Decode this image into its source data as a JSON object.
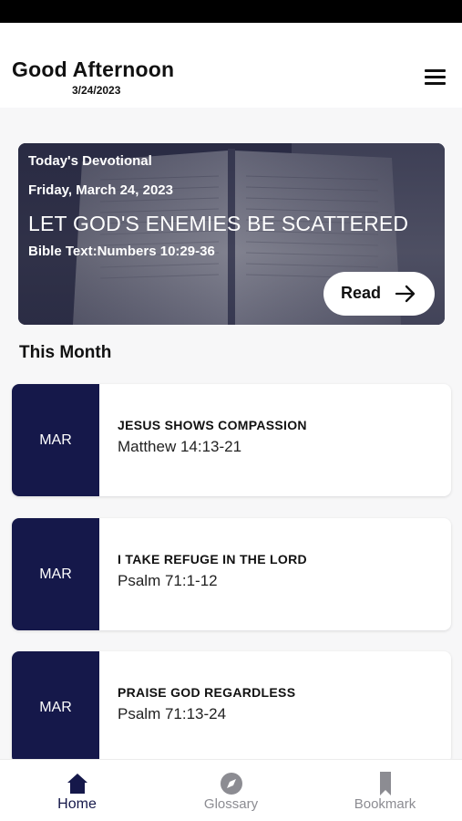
{
  "header": {
    "greeting": "Good Afternoon",
    "date": "3/24/2023",
    "menu_icon": "hamburger-menu-icon"
  },
  "hero": {
    "label": "Today's Devotional",
    "date": "Friday, March 24, 2023",
    "title": "LET GOD'S ENEMIES BE SCATTERED",
    "bible_text": "Bible Text:Numbers 10:29-36",
    "read_label": "Read",
    "read_icon": "arrow-right-icon"
  },
  "section": {
    "title": "This Month"
  },
  "devotionals": [
    {
      "month": "MAR",
      "title": "JESUS SHOWS COMPASSION",
      "reference": "Matthew 14:13-21"
    },
    {
      "month": "MAR",
      "title": "I TAKE REFUGE IN THE LORD",
      "reference": "Psalm 71:1-12"
    },
    {
      "month": "MAR",
      "title": "PRAISE GOD REGARDLESS",
      "reference": "Psalm 71:13-24"
    }
  ],
  "tabs": [
    {
      "label": "Home",
      "icon": "home-icon",
      "active": true
    },
    {
      "label": "Glossary",
      "icon": "compass-icon",
      "active": false
    },
    {
      "label": "Bookmark",
      "icon": "bookmark-icon",
      "active": false
    }
  ],
  "colors": {
    "primary": "#15184a",
    "inactive": "#8c8c92",
    "background": "#f7f7f8"
  }
}
